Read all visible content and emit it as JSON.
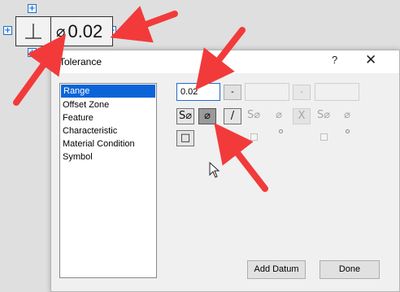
{
  "frame": {
    "diameter_symbol": "⌀",
    "tolerance_value": "0.02",
    "handle_icon": "plus-icon"
  },
  "dialog": {
    "title": "Tolerance",
    "help_label": "?",
    "close_label": "✕",
    "list_items": [
      "Range",
      "Offset Zone",
      "Feature",
      "Characteristic",
      "Material Condition",
      "Symbol"
    ],
    "selected_item": "Range",
    "range_value": "0.02",
    "dash_label": "-",
    "symbols_row1": [
      "S⌀",
      "⌀",
      "/",
      "S⌀",
      "⌀",
      "X",
      "S⌀",
      "⌀"
    ],
    "square_symbol": "□",
    "add_datum_label": "Add Datum",
    "done_label": "Done"
  },
  "annotation_color": "#f23a3a"
}
